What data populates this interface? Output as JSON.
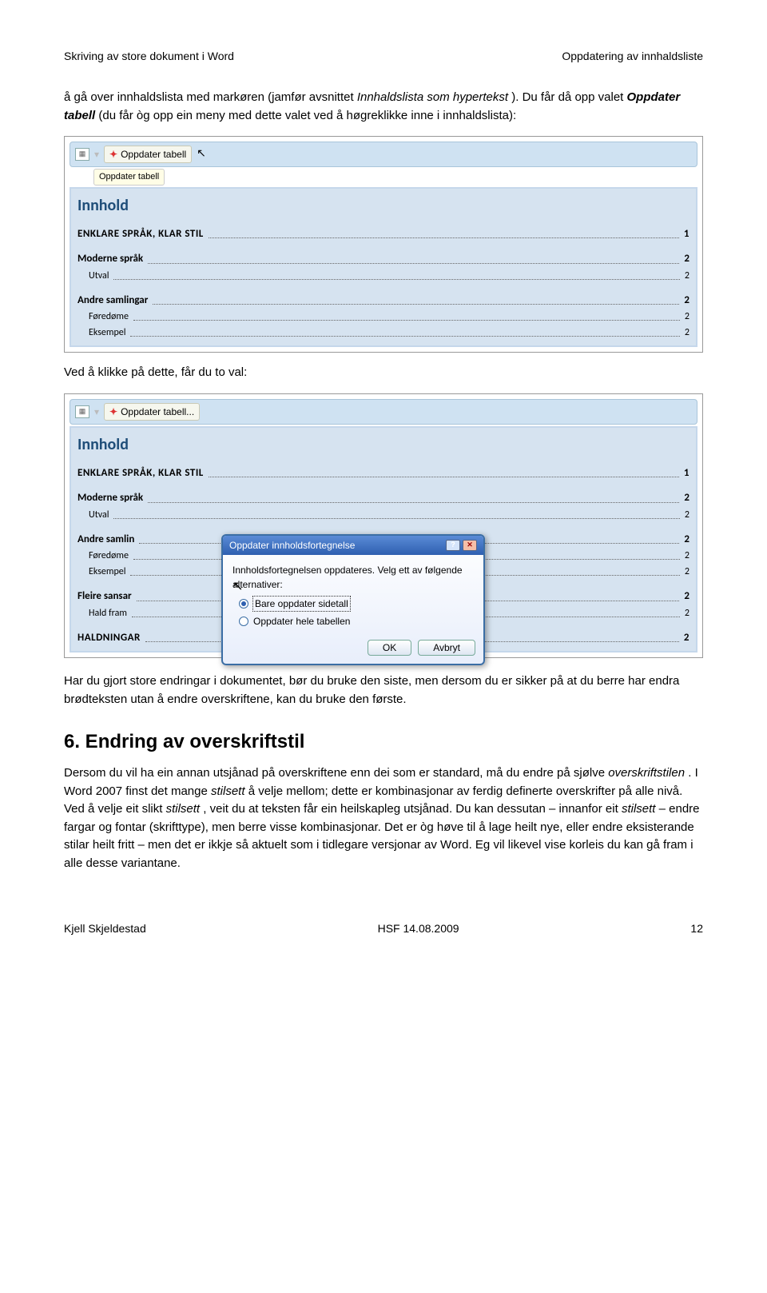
{
  "header": {
    "left": "Skriving av store dokument i Word",
    "right": "Oppdatering av innhaldsliste"
  },
  "para1": {
    "t1": "å gå over innhaldslista med markøren (jamfør avsnittet ",
    "t2": "Innhaldslista som hypertekst",
    "t3": "). Du får då opp valet ",
    "t4": "Oppdater tabell",
    "t5": " (du får òg opp ein meny med dette valet ved å høgreklikke inne i innhaldslista):"
  },
  "box1": {
    "oppdater_chip": "Oppdater tabell",
    "tooltip": "Oppdater tabell",
    "innhold": "Innhold",
    "rows": [
      {
        "t": "ENKLARE SPRÅK, KLAR STIL",
        "p": "1",
        "lvl": "lvl1-caps"
      },
      {
        "gap": true
      },
      {
        "t": "Moderne språk",
        "p": "2",
        "lvl": "lvl2"
      },
      {
        "t": "Utval",
        "p": "2",
        "lvl": "lvl3"
      },
      {
        "gap": true
      },
      {
        "t": "Andre samlingar",
        "p": "2",
        "lvl": "lvl2"
      },
      {
        "t": "Føredøme",
        "p": "2",
        "lvl": "lvl3"
      },
      {
        "t": "Eksempel",
        "p": "2",
        "lvl": "lvl3"
      }
    ]
  },
  "between1": "Ved å klikke på dette, får du to val:",
  "box2": {
    "oppdater_chip": "Oppdater tabell...",
    "innhold": "Innhold",
    "rows": [
      {
        "t": "ENKLARE SPRÅK, KLAR STIL",
        "p": "1",
        "lvl": "lvl1-caps"
      },
      {
        "gap": true
      },
      {
        "t": "Moderne språk",
        "p": "2",
        "lvl": "lvl2"
      },
      {
        "t": "Utval",
        "p": "2",
        "lvl": "lvl3"
      },
      {
        "gap": true
      },
      {
        "t": "Andre samlin",
        "p": "2",
        "lvl": "lvl2"
      },
      {
        "t": "Føredøme",
        "p": "2",
        "lvl": "lvl3"
      },
      {
        "t": "Eksempel",
        "p": "2",
        "lvl": "lvl3"
      },
      {
        "gap": true
      },
      {
        "t": "Fleire sansar",
        "p": "2",
        "lvl": "lvl2"
      },
      {
        "t": "Hald fram",
        "p": "2",
        "lvl": "lvl3"
      },
      {
        "gap": true
      },
      {
        "t": "HALDNINGAR",
        "p": "2",
        "lvl": "lvl1-caps"
      }
    ]
  },
  "dialog": {
    "title": "Oppdater innholdsfortegnelse",
    "msg": "Innholdsfortegnelsen oppdateres. Velg ett av følgende alternativer:",
    "opt1": "Bare oppdater sidetall",
    "opt2": "Oppdater hele tabellen",
    "ok": "OK",
    "cancel": "Avbryt"
  },
  "after2": "Har du gjort store endringar i dokumentet, bør du bruke den siste, men dersom du er sikker på at du berre har endra brødteksten utan å endre overskriftene, kan du bruke den første.",
  "h2": "6. Endring av overskriftstil",
  "para2": {
    "t1": "Dersom du vil ha ein annan utsjånad på overskriftene enn dei som er standard, må du endre på sjølve ",
    "t2": "overskriftstilen",
    "t3": ". I Word 2007 finst det mange ",
    "t4": "stilsett",
    "t5": " å velje mellom; dette er kombinasjonar av ferdig definerte overskrifter på alle nivå. Ved å velje eit slikt ",
    "t6": "stilsett",
    "t7": ", veit du at teksten får ein heilskapleg utsjånad. Du kan dessutan – innanfor eit ",
    "t8": "stilsett",
    "t9": " – endre fargar og fontar (skrifttype), men berre visse kombinasjonar. Det er òg høve til å lage heilt nye, eller endre eksisterande stilar heilt fritt – men det er ikkje så aktuelt som i tidlegare versjonar av Word. Eg vil likevel vise korleis du kan gå fram i alle desse variantane."
  },
  "footer": {
    "left": "Kjell Skjeldestad",
    "mid": "HSF 14.08.2009",
    "right": "12"
  }
}
